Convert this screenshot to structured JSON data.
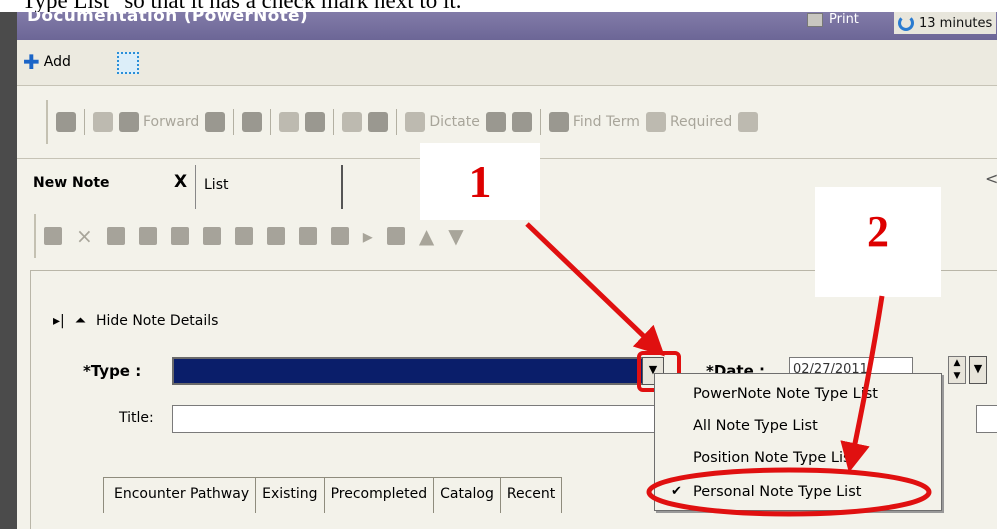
{
  "caption": "Type List\" so that it has a check mark next to it.",
  "window": {
    "title": "Documentation (PowerNote)",
    "print_label": "Print",
    "updated_label": "13 minutes"
  },
  "toolbar1": {
    "add_label": "Add"
  },
  "toolbar2": {
    "forward_label": "Forward",
    "dictate_label": "Dictate",
    "find_term_label": "Find Term",
    "required_label": "Required"
  },
  "tabs": {
    "new_note_label": "New Note",
    "close_glyph": "X",
    "list_label": "List",
    "scroll_glyph": "<"
  },
  "note": {
    "hide_label": "Hide Note Details",
    "type_label": "*Type :",
    "date_label": "*Date :",
    "date_value": "02/27/2011",
    "title_label": "Title:"
  },
  "panel_tabs": [
    "Encounter Pathway",
    "Existing",
    "Precompleted",
    "Catalog",
    "Recent"
  ],
  "type_menu": {
    "items": [
      {
        "label": "PowerNote Note Type List",
        "checked": false
      },
      {
        "label": "All Note Type List",
        "checked": false
      },
      {
        "label": "Position Note Type List",
        "checked": false
      },
      {
        "label": "Personal Note Type List",
        "checked": true
      }
    ],
    "check_glyph": "✔"
  },
  "annotations": {
    "step1": "1",
    "step2": "2",
    "color": "#e01010"
  },
  "colors": {
    "title_bar": "#6c6696",
    "type_field": "#0a1e6a",
    "panel_bg": "#f3f2ea"
  }
}
